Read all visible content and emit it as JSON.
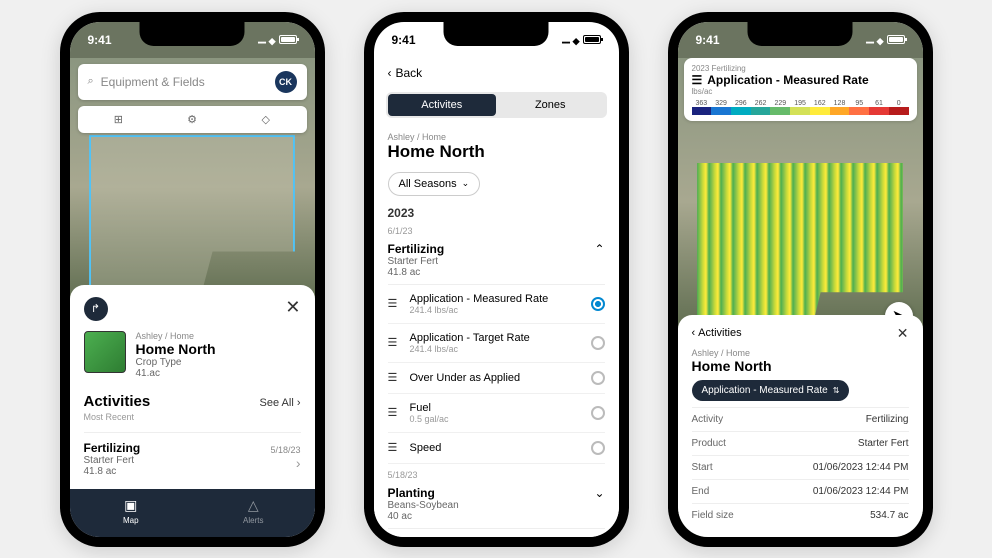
{
  "status_time": "9:41",
  "phone1": {
    "search_placeholder": "Equipment & Fields",
    "avatar": "CK",
    "crumb": "Ashley / Home",
    "field_name": "Home North",
    "crop_type": "Crop Type",
    "acres": "41.ac",
    "activities_title": "Activities",
    "see_all": "See All",
    "most_recent": "Most Recent",
    "act_name": "Fertilizing",
    "act_sub": "Starter Fert",
    "act_ac": "41.8 ac",
    "act_date": "5/18/23",
    "nav_map": "Map",
    "nav_alerts": "Alerts"
  },
  "phone2": {
    "back": "Back",
    "tab1": "Activites",
    "tab2": "Zones",
    "crumb": "Ashley / Home",
    "field_name": "Home North",
    "filter": "All Seasons",
    "year": "2023",
    "date1": "6/1/23",
    "exp1_title": "Fertilizing",
    "exp1_sub": "Starter Fert",
    "exp1_ac": "41.8 ac",
    "layers": [
      {
        "name": "Application - Measured Rate",
        "val": "241.4 lbs/ac",
        "on": true
      },
      {
        "name": "Application - Target Rate",
        "val": "241.4 lbs/ac",
        "on": false
      },
      {
        "name": "Over Under as Applied",
        "val": "",
        "on": false
      },
      {
        "name": "Fuel",
        "val": "0.5 gal/ac",
        "on": false
      },
      {
        "name": "Speed",
        "val": "",
        "on": false
      }
    ],
    "date2": "5/18/23",
    "exp2_title": "Planting",
    "exp2_sub": "Beans-Soybean",
    "exp2_ac": "40 ac"
  },
  "phone3": {
    "leg_sub": "2023 Fertilizing",
    "leg_title": "Application - Measured Rate",
    "leg_unit": "lbs/ac",
    "legend": [
      {
        "v": "363",
        "c": "#1a237e"
      },
      {
        "v": "329",
        "c": "#1976d2"
      },
      {
        "v": "296",
        "c": "#00acc1"
      },
      {
        "v": "262",
        "c": "#26a69a"
      },
      {
        "v": "229",
        "c": "#66bb6a"
      },
      {
        "v": "195",
        "c": "#d4e157"
      },
      {
        "v": "162",
        "c": "#ffeb3b"
      },
      {
        "v": "128",
        "c": "#ffa726"
      },
      {
        "v": "95",
        "c": "#ff7043"
      },
      {
        "v": "61",
        "c": "#e53935"
      },
      {
        "v": "0",
        "c": "#b71c1c"
      }
    ],
    "activities_back": "Activities",
    "crumb": "Ashley / Home",
    "field_name": "Home North",
    "chip": "Application - Measured Rate",
    "kv": [
      {
        "k": "Activity",
        "v": "Fertilizing"
      },
      {
        "k": "Product",
        "v": "Starter Fert"
      },
      {
        "k": "Start",
        "v": "01/06/2023 12:44 PM"
      },
      {
        "k": "End",
        "v": "01/06/2023 12:44 PM"
      },
      {
        "k": "Field size",
        "v": "534.7 ac"
      }
    ]
  }
}
